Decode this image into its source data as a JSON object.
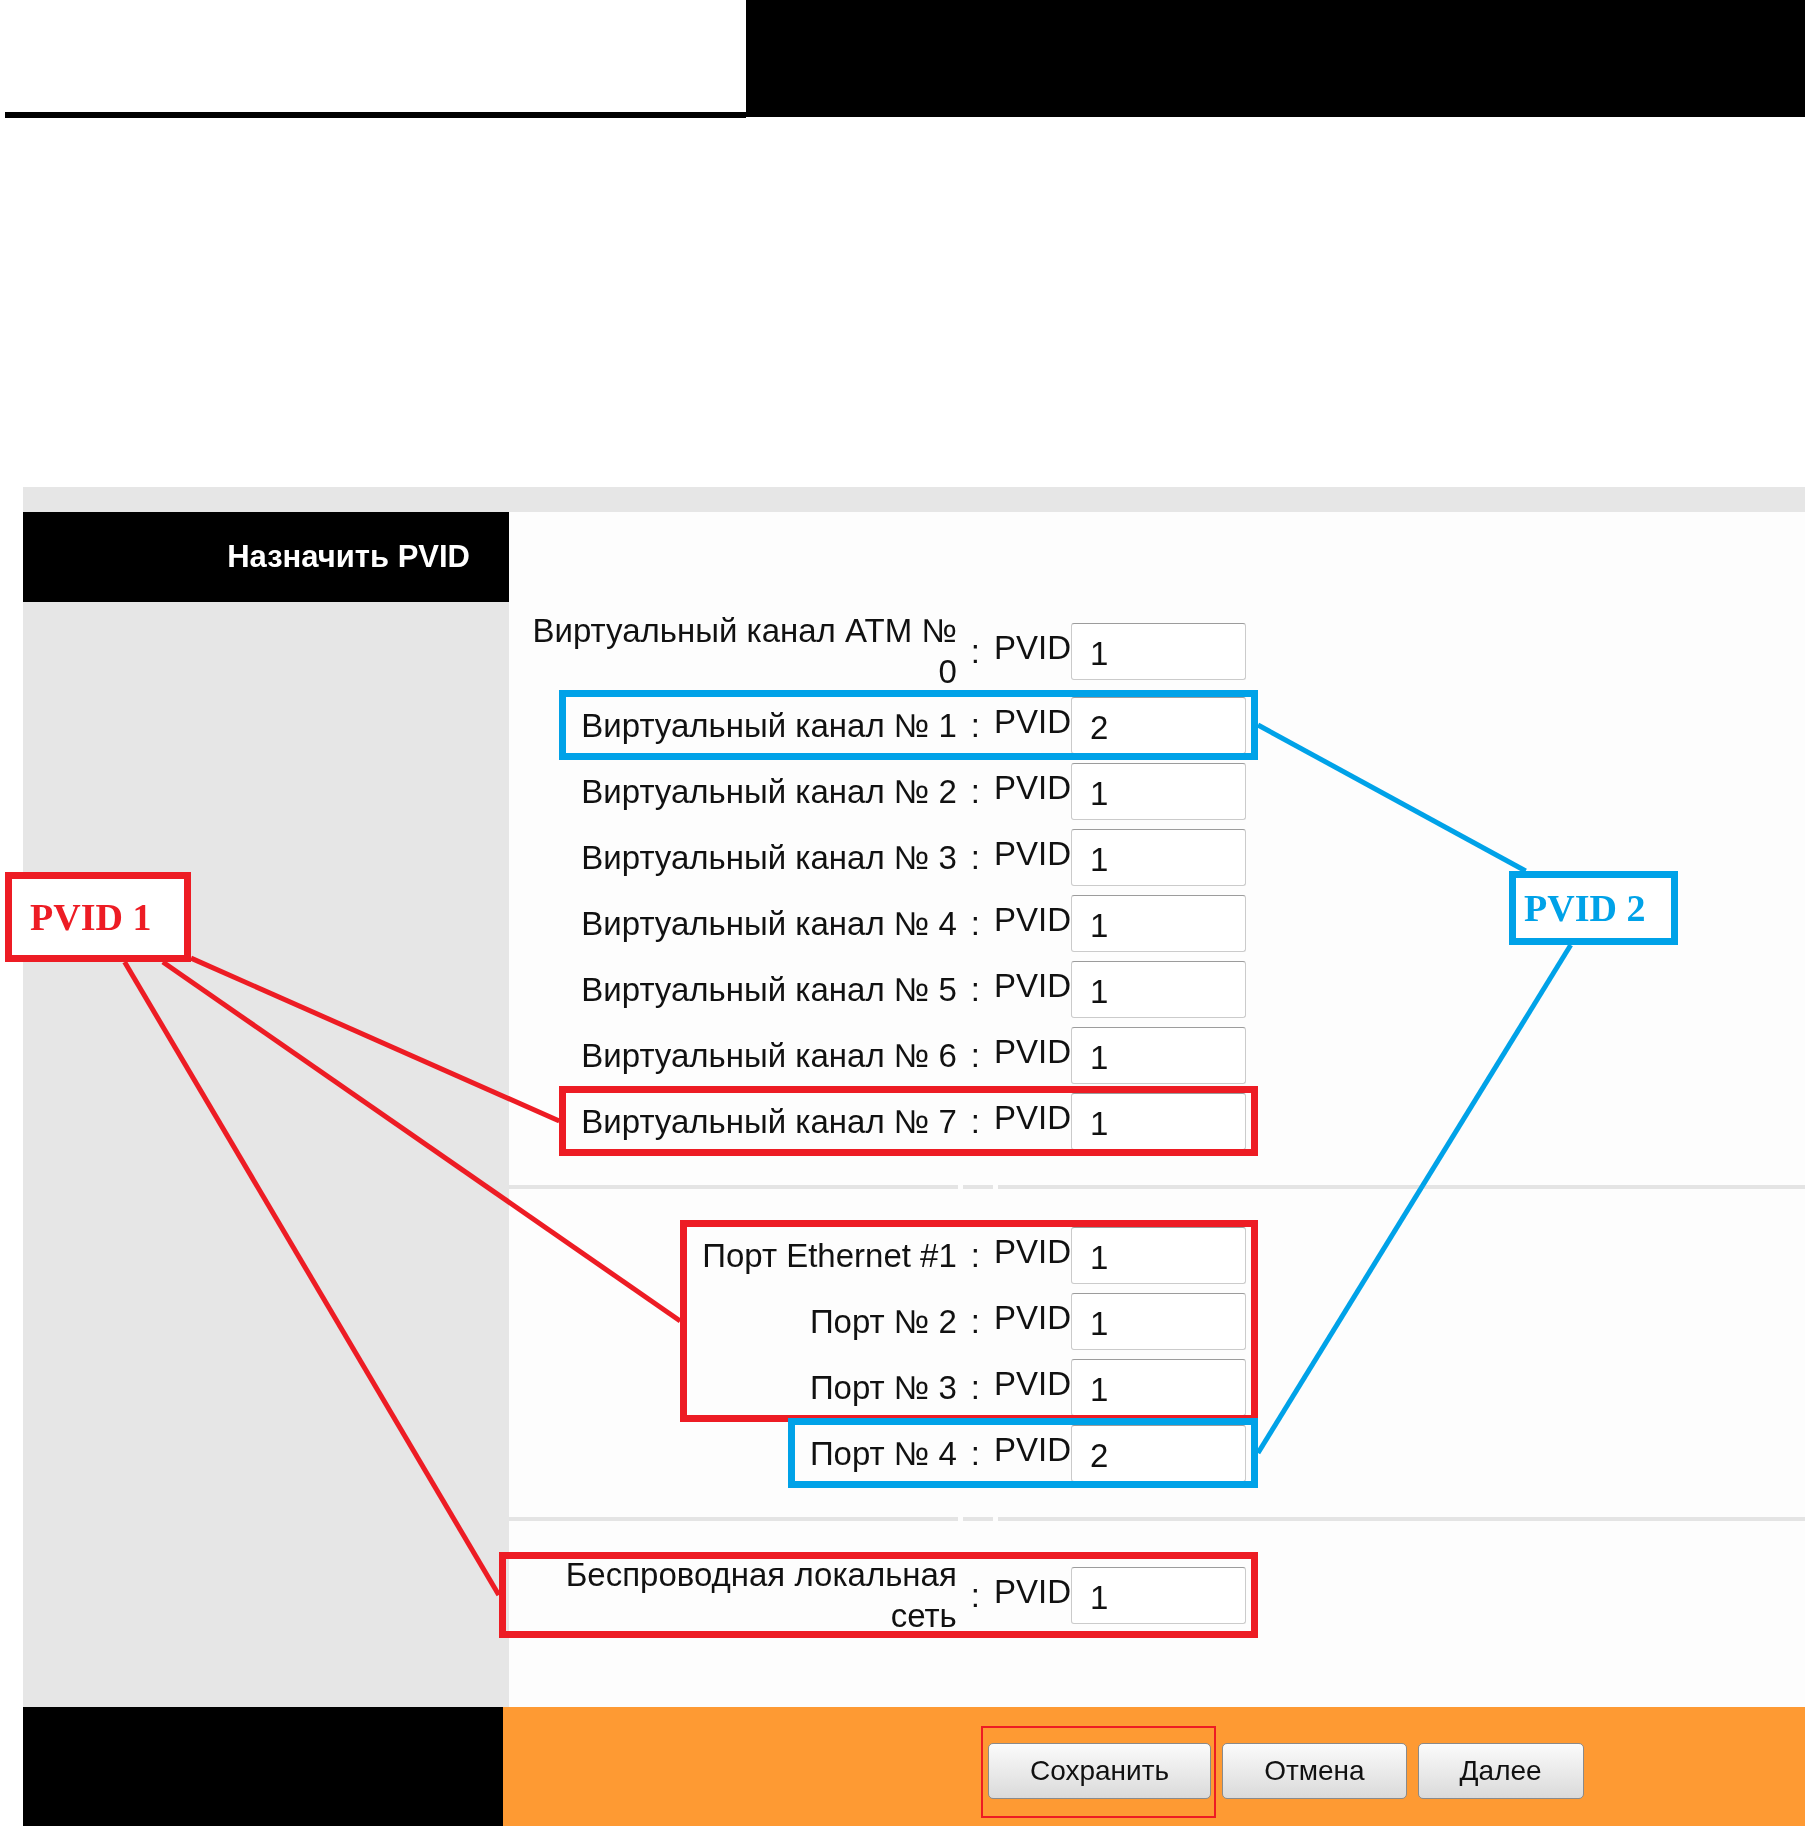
{
  "section": {
    "title": "Назначить PVID"
  },
  "groups": [
    {
      "blocks": [
        {
          "rows": [
            {
              "label": "Виртуальный канал ATM № 0",
              "separator": ":",
              "field_label": "PVID",
              "value": "1"
            }
          ]
        },
        {
          "frame": {
            "color": "#00a2e8"
          },
          "rows": [
            {
              "label": "Виртуальный канал № 1",
              "separator": ":",
              "field_label": "PVID",
              "value": "2"
            }
          ]
        },
        {
          "rows": [
            {
              "label": "Виртуальный канал № 2",
              "separator": ":",
              "field_label": "PVID",
              "value": "1"
            },
            {
              "label": "Виртуальный канал № 3",
              "separator": ":",
              "field_label": "PVID",
              "value": "1"
            },
            {
              "label": "Виртуальный канал № 4",
              "separator": ":",
              "field_label": "PVID",
              "value": "1"
            },
            {
              "label": "Виртуальный канал № 5",
              "separator": ":",
              "field_label": "PVID",
              "value": "1"
            },
            {
              "label": "Виртуальный канал № 6",
              "separator": ":",
              "field_label": "PVID",
              "value": "1"
            }
          ]
        },
        {
          "frame": {
            "color": "#ed1c24"
          },
          "rows": [
            {
              "label": "Виртуальный канал № 7",
              "separator": ":",
              "field_label": "PVID",
              "value": "1"
            }
          ]
        }
      ]
    },
    {
      "blocks": [
        {
          "frame": {
            "color": "#ed1c24"
          },
          "rows": [
            {
              "label": "Порт Ethernet #1",
              "separator": ":",
              "field_label": "PVID",
              "value": "1"
            },
            {
              "label": "Порт № 2",
              "separator": ":",
              "field_label": "PVID",
              "value": "1"
            },
            {
              "label": "Порт № 3",
              "separator": ":",
              "field_label": "PVID",
              "value": "1"
            }
          ]
        },
        {
          "frame": {
            "color": "#00a2e8"
          },
          "rows": [
            {
              "label": "Порт № 4",
              "separator": ":",
              "field_label": "PVID",
              "value": "2"
            }
          ]
        }
      ]
    },
    {
      "blocks": [
        {
          "frame": {
            "color": "#ed1c24"
          },
          "rows": [
            {
              "label": "Беспроводная локальная сеть",
              "separator": ":",
              "field_label": "PVID",
              "value": "1"
            }
          ]
        }
      ]
    }
  ],
  "buttons": [
    {
      "label": "Сохранить",
      "frame": {
        "color": "#ed1c24"
      }
    },
    {
      "label": "Отмена"
    },
    {
      "label": "Далее"
    }
  ],
  "callouts": [
    {
      "label": "PVID 1",
      "color": "#ed1c24"
    },
    {
      "label": "PVID 2",
      "color": "#00a2e8"
    }
  ]
}
